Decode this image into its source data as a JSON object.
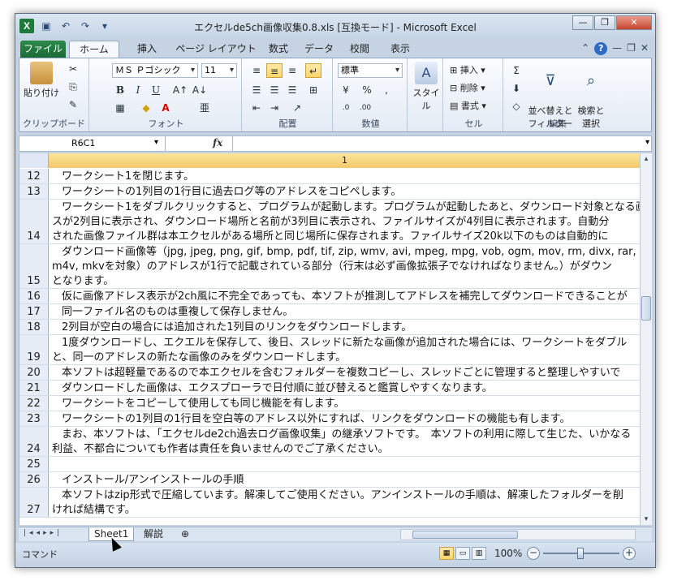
{
  "window": {
    "title": "エクセルde5ch画像収集0.8.xls  [互換モード]  -  Microsoft Excel",
    "logo": "X",
    "qat_icons": [
      "save-icon",
      "undo-icon",
      "redo-icon"
    ],
    "controls": {
      "minimize": "—",
      "restore": "❐",
      "close": "✕"
    }
  },
  "ribbon_tabs": [
    "ファイル",
    "ホーム",
    "挿入",
    "ページ レイアウト",
    "数式",
    "データ",
    "校閲",
    "表示"
  ],
  "ribbon": {
    "clipboard": {
      "paste": "貼り付け",
      "label": "クリップボード"
    },
    "font": {
      "name": "ＭＳ Ｐゴシック",
      "size": "11",
      "label": "フォント"
    },
    "alignment": {
      "label": "配置"
    },
    "number": {
      "format": "標準",
      "label": "数値"
    },
    "styles": {
      "button": "スタイル"
    },
    "cells": {
      "insert": "挿入",
      "delete": "削除",
      "format": "書式",
      "label": "セル"
    },
    "editing": {
      "sort_filter": "並べ替えと\nフィルター",
      "find_select": "検索と\n選択",
      "label": "編集"
    }
  },
  "formula_bar": {
    "name_box": "R6C1",
    "fx": "fx",
    "value": ""
  },
  "sheet": {
    "column_header": "1",
    "rows": [
      {
        "num": "12",
        "lines": [
          "ワークシート1を閉じます。"
        ]
      },
      {
        "num": "13",
        "lines": [
          "ワークシートの1列目の1行目に過去ログ等のアドレスをコピペします。"
        ]
      },
      {
        "num": "14",
        "lines": [
          "ワークシート1をダブルクリックすると、プログラムが起動します。プログラムが起動したあと、ダウンロード対象となる画",
          "スが2列目に表示され、ダウンロード場所と名前が3列目に表示され、ファイルサイズが4列目に表示されます。自動分",
          "された画像ファイル群は本エクセルがある場所と同じ場所に保存されます。ファイルサイズ20k以下のものは自動的に"
        ]
      },
      {
        "num": "15",
        "lines": [
          "ダウンロード画像等（jpg, jpeg, png, gif, bmp, pdf, tif, zip, wmv, avi, mpeg, mpg, vob, ogm, mov, rm, divx, rar, as",
          "m4v, mkvを対象）のアドレスが1行で記載されている部分（行末は必ず画像拡張子でなければなりません。）がダウン",
          "となります。"
        ]
      },
      {
        "num": "16",
        "lines": [
          "仮に画像アドレス表示が2ch風に不完全であっても、本ソフトが推測してアドレスを補完してダウンロードできることが"
        ]
      },
      {
        "num": "17",
        "lines": [
          "同一ファイル名のものは重複して保存しません。"
        ]
      },
      {
        "num": "18",
        "lines": [
          "2列目が空白の場合には追加された1列目のリンクをダウンロードします。"
        ]
      },
      {
        "num": "19",
        "lines": [
          "1度ダウンロードし、エクエルを保存して、後日、スレッドに新たな画像が追加された場合には、ワークシートをダブル",
          "と、同一のアドレスの新たな画像のみをダウンロードします。"
        ]
      },
      {
        "num": "20",
        "lines": [
          "本ソフトは超軽量であるので本エクセルを含むフォルダーを複数コピーし、スレッドごとに管理すると整理しやすいで"
        ]
      },
      {
        "num": "21",
        "lines": [
          "ダウンロードした画像は、エクスプローラで日付順に並び替えると鑑賞しやすくなります。"
        ]
      },
      {
        "num": "22",
        "lines": [
          "ワークシートをコピーして使用しても同じ機能を有します。"
        ]
      },
      {
        "num": "23",
        "lines": [
          "ワークシートの1列目の1行目を空白等のアドレス以外にすれば、リンクをダウンロードの機能も有します。"
        ]
      },
      {
        "num": "24",
        "lines": [
          "まお、本ソフトは、「エクセルde2ch過去ログ画像収集」の継承ソフトです。　本ソフトの利用に際して生じた、いかなる",
          "利益、不都合についても作者は責任を負いませんのでご了承ください。"
        ]
      },
      {
        "num": "25",
        "lines": [
          ""
        ]
      },
      {
        "num": "26",
        "lines": [
          "インストール/アンインストールの手順"
        ]
      },
      {
        "num": "27",
        "lines": [
          "本ソフトはzip形式で圧縮しています。解凍してご使用ください。アンインストールの手順は、解凍したフォルダーを削",
          "ければ結構です。"
        ]
      }
    ]
  },
  "sheet_tabs": [
    "Sheet1",
    "解説"
  ],
  "status": {
    "mode": "コマンド",
    "zoom": "100%"
  }
}
